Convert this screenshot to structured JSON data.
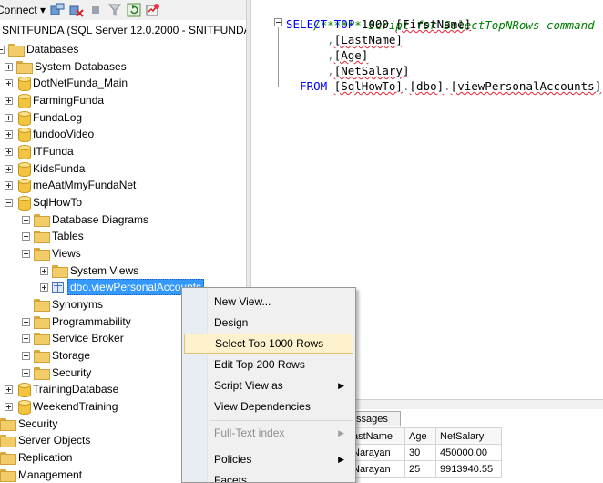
{
  "explorer": {
    "toolbar": {
      "connect_label": "Connect ▾"
    },
    "server": "SNITFUNDA (SQL Server 12.0.2000 - SNITFUNDA\\",
    "databases_label": "Databases",
    "databases": [
      "System Databases",
      "DotNetFunda_Main",
      "FarmingFunda",
      "FundaLog",
      "fundooVideo",
      "ITFunda",
      "KidsFunda",
      "meAatMmyFundaNet",
      "SqlHowTo"
    ],
    "sqlhowto_children": [
      "Database Diagrams",
      "Tables",
      "Views"
    ],
    "views_children": [
      "System Views",
      "dbo.viewPersonalAccounts"
    ],
    "sqlhowto_more": [
      "Synonyms",
      "Programmability",
      "Service Broker",
      "Storage",
      "Security"
    ],
    "other_databases": [
      "TrainingDatabase",
      "WeekendTraining"
    ],
    "server_nodes": [
      "Security",
      "Server Objects",
      "Replication",
      "Management"
    ]
  },
  "editor": {
    "comment": "/****** Script for SelectTopNRows command from S",
    "kw_select": "SELECT",
    "kw_top": "TOP",
    "top_n": " 1000 ",
    "col1": "[FirstName]",
    "col2": "[LastName]",
    "col3": "[Age]",
    "col4": "[NetSalary]",
    "kw_from": "FROM",
    "from_schema": "[SqlHowTo]",
    "from_dbo": "[dbo]",
    "from_view": "[viewPersonalAccounts]"
  },
  "results": {
    "tab_label": "ssages",
    "columns": [
      "astName",
      "Age",
      "NetSalary"
    ],
    "rows": [
      [
        "Narayan",
        "30",
        "450000.00"
      ],
      [
        "Narayan",
        "25",
        "9913940.55"
      ]
    ]
  },
  "context_menu": {
    "items": [
      "New View...",
      "Design",
      "Select Top 1000 Rows",
      "Edit Top 200 Rows",
      "Script View as",
      "View Dependencies",
      "Full-Text index",
      "Policies",
      "Facets"
    ],
    "arrow": "▶"
  },
  "colors": {
    "selection": "#3399ff",
    "menu_highlight": "#fdf2cd",
    "keyword": "#0000ff",
    "comment": "#008000"
  }
}
